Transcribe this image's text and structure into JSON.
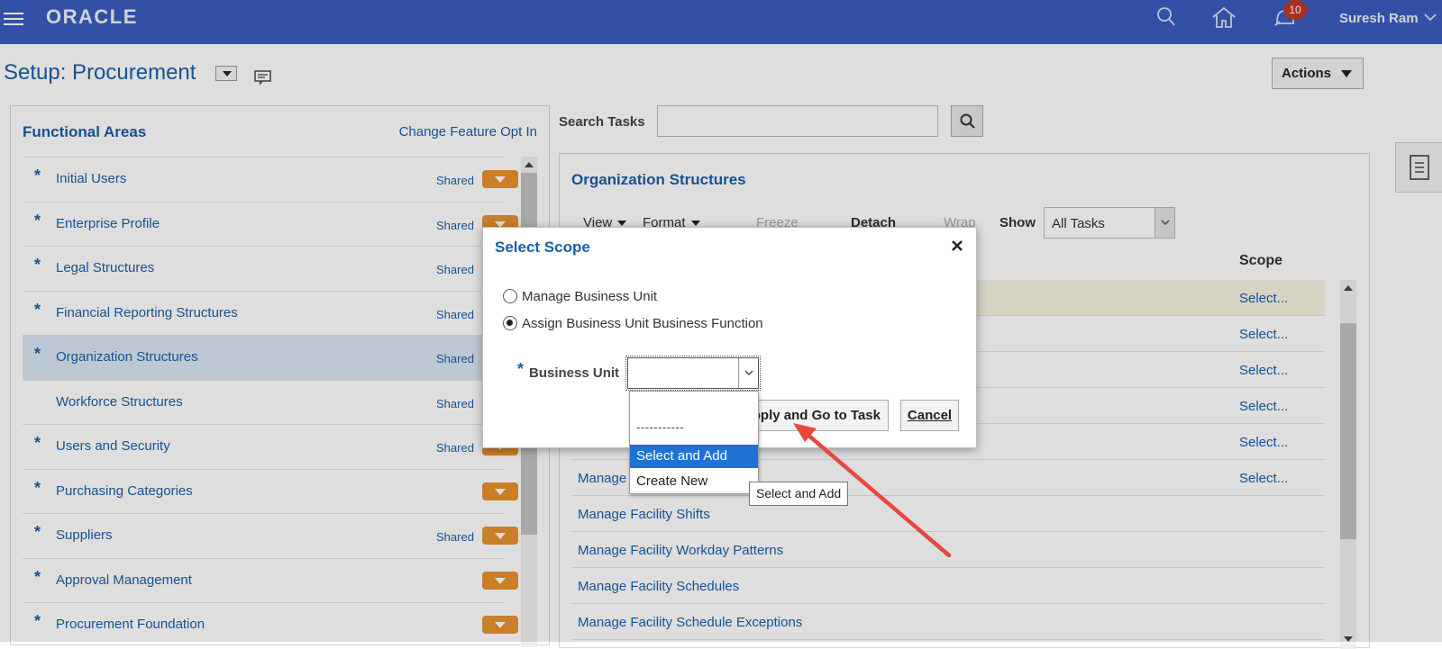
{
  "header": {
    "logo": "ORACLE",
    "notification_count": "10",
    "user_name": "Suresh Ram"
  },
  "page": {
    "title": "Setup: Procurement",
    "actions_label": "Actions"
  },
  "functional_areas": {
    "title": "Functional Areas",
    "change_link": "Change Feature Opt In",
    "shared_text": "Shared",
    "items": [
      {
        "label": "Initial Users",
        "required": true,
        "shared": true
      },
      {
        "label": "Enterprise Profile",
        "required": true,
        "shared": true
      },
      {
        "label": "Legal Structures",
        "required": true,
        "shared": true
      },
      {
        "label": "Financial Reporting Structures",
        "required": true,
        "shared": true
      },
      {
        "label": "Organization Structures",
        "required": true,
        "shared": true,
        "selected": true
      },
      {
        "label": "Workforce Structures",
        "required": false,
        "shared": true
      },
      {
        "label": "Users and Security",
        "required": true,
        "shared": true
      },
      {
        "label": "Purchasing Categories",
        "required": true,
        "shared": false
      },
      {
        "label": "Suppliers",
        "required": true,
        "shared": true
      },
      {
        "label": "Approval Management",
        "required": true,
        "shared": false
      },
      {
        "label": "Procurement Foundation",
        "required": true,
        "shared": false
      }
    ]
  },
  "search": {
    "label": "Search Tasks",
    "value": ""
  },
  "org_structures": {
    "title": "Organization Structures",
    "toolbar": {
      "view": "View",
      "format": "Format",
      "freeze": "Freeze",
      "detach": "Detach",
      "wrap": "Wrap"
    },
    "show_label": "Show",
    "show_value": "All Tasks",
    "scope_header": "Scope",
    "rows": [
      {
        "task": "",
        "scope": "Select..."
      },
      {
        "task": "",
        "scope": "Select..."
      },
      {
        "task": "",
        "scope": "Select..."
      },
      {
        "task": "",
        "scope": "Select..."
      },
      {
        "task": "",
        "scope": "Select..."
      },
      {
        "task": "Manage",
        "scope": "Select..."
      },
      {
        "task": "Manage Facility Shifts",
        "scope": ""
      },
      {
        "task": "Manage Facility Workday Patterns",
        "scope": ""
      },
      {
        "task": "Manage Facility Schedules",
        "scope": ""
      },
      {
        "task": "Manage Facility Schedule Exceptions",
        "scope": ""
      }
    ]
  },
  "dialog": {
    "title": "Select Scope",
    "option_manage": "Manage Business Unit",
    "option_assign": "Assign Business Unit Business Function",
    "business_unit_label": "Business Unit",
    "apply_label": "pply and Go to Task",
    "cancel_label": "Cancel"
  },
  "dropdown": {
    "separator": "-----------",
    "options": [
      "Select and Add",
      "Create New"
    ],
    "selected": "Select and Add",
    "tooltip": "Select and Add"
  },
  "colors": {
    "header_bg": "#3a5cbf",
    "link_blue": "#1a5fa8",
    "toggle_orange": "#e8912d",
    "badge_red": "#c0392b",
    "dropdown_highlight": "#1e73d2",
    "annotation_arrow": "#e8473f"
  }
}
